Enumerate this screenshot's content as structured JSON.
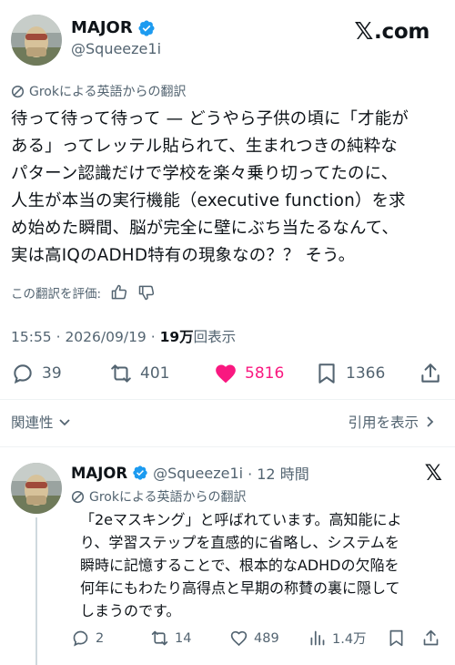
{
  "post": {
    "display_name": "MAJOR",
    "handle": "@Squeeze1i",
    "brand_text": ".com",
    "translation_note": "Grokによる英語からの翻訳",
    "text": "待って待って待って — どうやら子供の頃に「才能が\nある」ってレッテル貼られて、生まれつきの純粋な\nパターン認識だけで学校を楽々乗り切ってたのに、\n人生が本当の実行機能（executive function）を求\nめ始めた瞬間、脳が完全に壁にぶち当たるなんて、\n実は高IQのADHD特有の現象なの？？ そう。",
    "rate_label": "この翻訳を評価:",
    "timestamp": "15:55 · 2026/09/19 · ",
    "views_count": "19万",
    "views_label": "回表示",
    "stats": {
      "replies": "39",
      "reposts": "401",
      "likes": "5816",
      "bookmarks": "1366"
    }
  },
  "footer": {
    "related_label": "関連性",
    "quotes_label": "引用を表示"
  },
  "reply": {
    "display_name": "MAJOR",
    "handle": "@Squeeze1i",
    "age": "· 12 時間",
    "translation_note": "Grokによる英語からの翻訳",
    "text": "「2eマスキング」と呼ばれています。高知能によ\nり、学習ステップを直感的に省略し、システムを\n瞬時に記憶することで、根本的なADHDの欠陥を\n何年にもわたり高得点と早期の称賛の裏に隠して\nしまうのです。",
    "stats": {
      "replies": "2",
      "reposts": "14",
      "likes": "489",
      "views": "1.4万"
    }
  },
  "colors": {
    "verified": "#1d9bf0",
    "like_active": "#f91880",
    "secondary_text": "#536471"
  },
  "icons": [
    "verified-badge-icon",
    "grok-icon",
    "thumbs-up-icon",
    "thumbs-down-icon",
    "reply-icon",
    "repost-icon",
    "like-icon",
    "bookmark-icon",
    "share-icon",
    "chevron-down-icon",
    "chevron-right-icon",
    "x-logo-icon",
    "views-icon"
  ]
}
